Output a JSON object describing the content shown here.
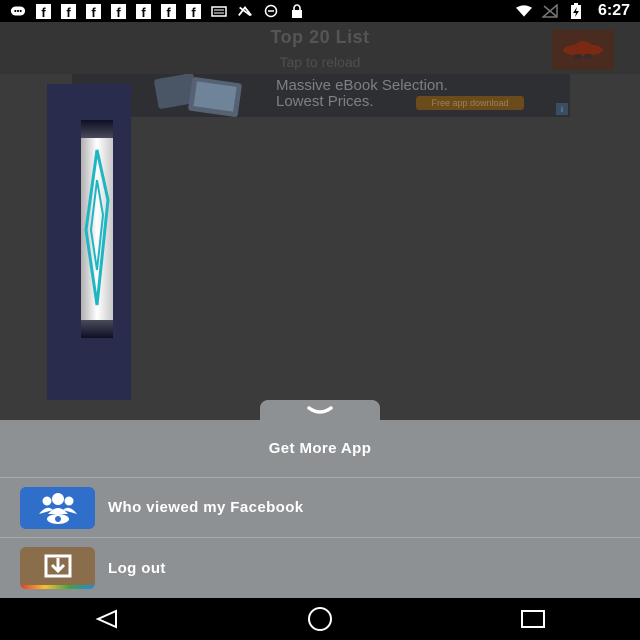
{
  "status_bar": {
    "time": "6:27",
    "left_icons": [
      "messenger-icon",
      "facebook-icon",
      "facebook-icon",
      "facebook-icon",
      "facebook-icon",
      "facebook-icon",
      "facebook-icon",
      "facebook-icon",
      "sim-card-icon",
      "sync-icon",
      "alarm-icon",
      "lock-icon"
    ],
    "right_icons": [
      "wifi-icon",
      "signal-off-icon",
      "battery-charging-icon"
    ],
    "facebook_glyph": "f"
  },
  "header": {
    "title": "Top 20 List",
    "subtitle": "Tap to reload"
  },
  "ad": {
    "line1": "Massive eBook Selection.",
    "line2": "Lowest Prices.",
    "cta": "Free app download"
  },
  "sheet": {
    "title": "Get More App",
    "items": [
      {
        "label": "Who viewed my Facebook",
        "icon": "profile-viewers-icon",
        "icon_color": "#2f6ec9"
      },
      {
        "label": "Log out",
        "icon": "download-box-icon",
        "icon_color": "#8a6e4b"
      }
    ]
  },
  "nav": {
    "icons": [
      "back-icon",
      "home-icon",
      "recents-icon"
    ]
  }
}
